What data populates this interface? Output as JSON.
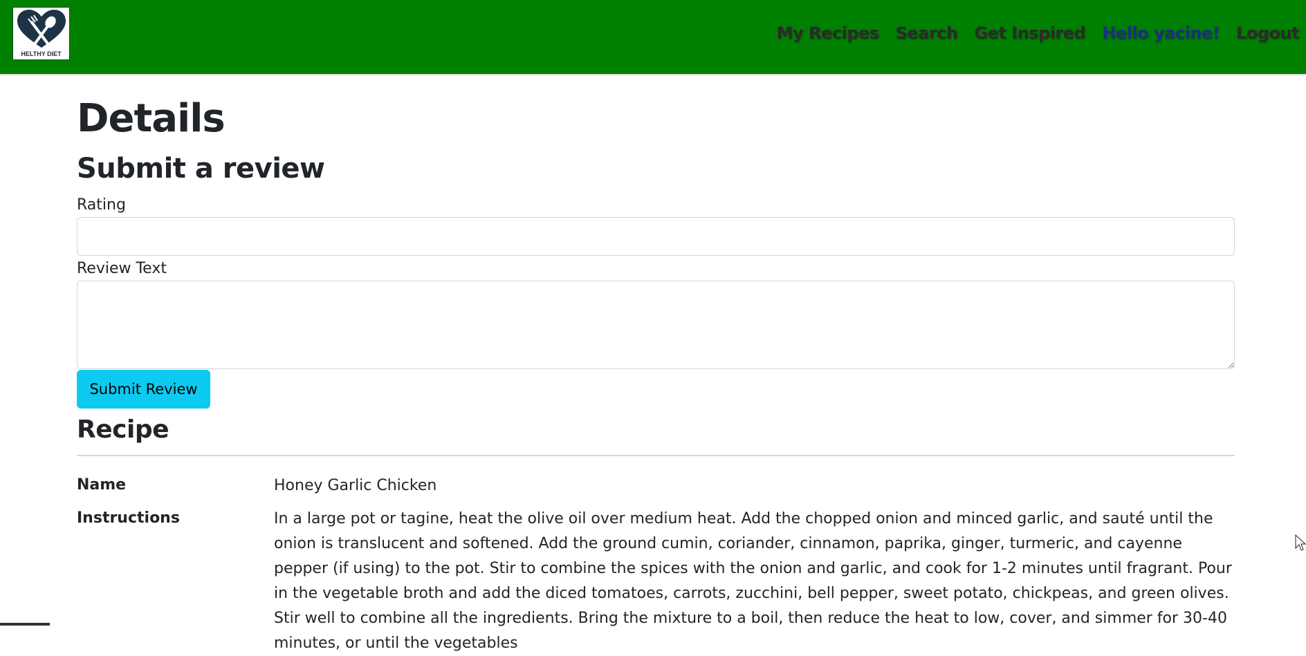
{
  "brand": {
    "logo_text": "HELTHY DIET"
  },
  "nav": {
    "links": [
      "My Recipes",
      "Search",
      "Get Inspired",
      "Hello yacine!",
      "Logout"
    ]
  },
  "page": {
    "title": "Details"
  },
  "review_form": {
    "heading": "Submit a review",
    "rating_label": "Rating",
    "rating_value": "",
    "review_label": "Review Text",
    "review_value": "",
    "submit_label": "Submit Review"
  },
  "recipe": {
    "heading": "Recipe",
    "name_label": "Name",
    "name_value": "Honey Garlic Chicken",
    "instructions_label": "Instructions",
    "instructions_value": "In a large pot or tagine, heat the olive oil over medium heat. Add the chopped onion and minced garlic, and sauté until the onion is translucent and softened. Add the ground cumin, coriander, cinnamon, paprika, ginger, turmeric, and cayenne pepper (if using) to the pot. Stir to combine the spices with the onion and garlic, and cook for 1-2 minutes until fragrant. Pour in the vegetable broth and add the diced tomatoes, carrots, zucchini, bell pepper, sweet potato, chickpeas, and green olives. Stir well to combine all the ingredients. Bring the mixture to a boil, then reduce the heat to low, cover, and simmer for 30-40 minutes, or until the vegetables"
  },
  "colors": {
    "navbar": "#008000",
    "button": "#0dcaf0",
    "hello_link": "#1d2f80"
  }
}
